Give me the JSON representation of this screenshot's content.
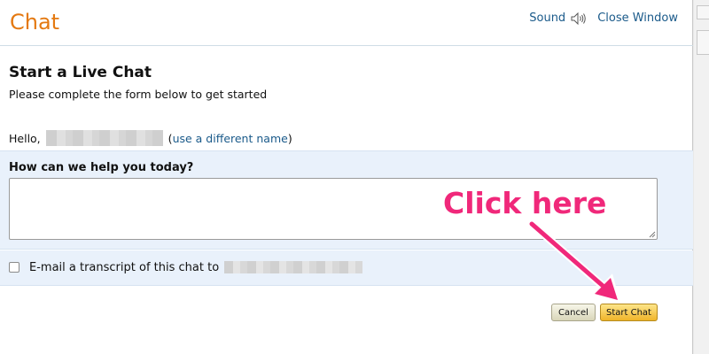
{
  "header": {
    "title": "Chat",
    "sound_label": "Sound",
    "close_label": "Close Window"
  },
  "form": {
    "heading": "Start a Live Chat",
    "subheading": "Please complete the form below to get started",
    "hello_prefix": "Hello,",
    "open_paren": "(",
    "different_name_link": "use a different name",
    "close_paren": ")",
    "help_label": "How can we help you today?",
    "help_value": "",
    "transcript_label": "E-mail a transcript of this chat to",
    "transcript_checked": false
  },
  "buttons": {
    "cancel": "Cancel",
    "start_chat": "Start Chat"
  },
  "annotation": {
    "text": "Click here",
    "color": "#f0287a"
  },
  "colors": {
    "title": "#e47911",
    "link": "#1a5a8a",
    "panel_bg": "#e9f1fb",
    "start_button": "#f0b429"
  }
}
